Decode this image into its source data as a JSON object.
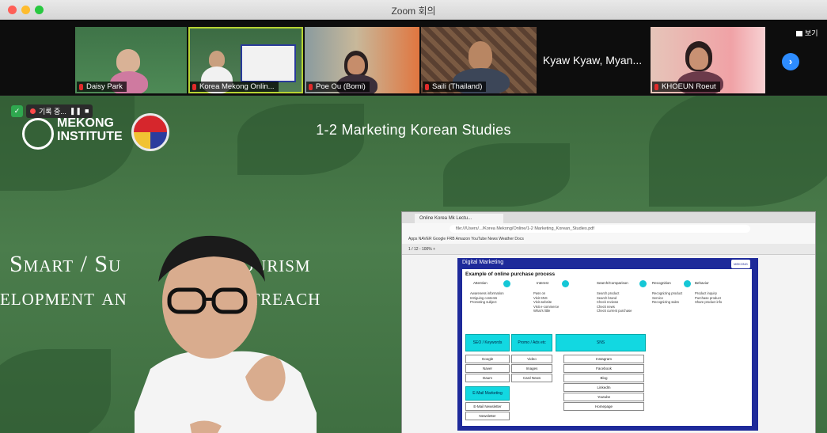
{
  "window": {
    "title": "Zoom 회의"
  },
  "strip": {
    "participants": [
      {
        "name": "Daisy Park",
        "active": false
      },
      {
        "name": "Korea Mekong Onlin...",
        "active": true
      },
      {
        "name": "Poe Ou (Bomi)",
        "active": false
      },
      {
        "name": "Saili (Thailand)",
        "active": false
      },
      {
        "name": "KHOEUN Roeut",
        "active": false
      }
    ],
    "name_only_tile": "Kyaw Kyaw, Myan...",
    "view_label": "보기"
  },
  "recording": {
    "label": "기록 중..."
  },
  "slide": {
    "logo_line1": "MEKONG",
    "logo_line2": "INSTITUTE",
    "title": "1-2 Marketing Korean Studies",
    "banner_line1": "Smart / Su             e Tourism",
    "banner_line2": "elopment an        ess Outreach"
  },
  "shared_screen": {
    "tab_title": "Online Korea Mk Lectu...",
    "url": "file:///Users/.../Korea Mekong/Online/1-2 Marketing_Korean_Studies.pdf",
    "bookmarks": "Apps   NAVER   Google   FRB   Amazon   YouTube   News   Weather   Docs",
    "pdf_toolbar": "1 / 12      -   100%   +",
    "doc_heading": "Digital Marketing",
    "doc_logo": "MEKONG INSTITUTE",
    "example_title": "Example of online purchase process",
    "flow_steps": [
      "Attention",
      "Interest",
      "Search/Comparison",
      "Recognition",
      "Behavior"
    ],
    "flow_details": [
      "Awareness information\nIntriguing contents\nPromoting subject",
      "Pass on\nVisit SNS\nVisit website\nVisit e-commerce\nWhat's little",
      "Search product\nSearch brand\nCheck reviews\nCheck news\nCheck current purchase",
      "Recognizing product\nService\nRecognizing sales",
      "Product inquiry\nPurchase product\nShare product info"
    ],
    "teal_boxes": [
      "SEO / Keywords",
      "Promo / Ads etc",
      "SNS",
      "E-Mail Marketing"
    ],
    "col1_items": [
      "Google",
      "Naver",
      "Daum",
      "E-Mail Newsletter",
      "Newsletter"
    ],
    "col2_items": [
      "Video",
      "Images",
      "Card News"
    ],
    "col3_items": [
      "Instagram",
      "Facebook",
      "Blog",
      "LinkedIn",
      "Youtube",
      "Homepage"
    ]
  }
}
